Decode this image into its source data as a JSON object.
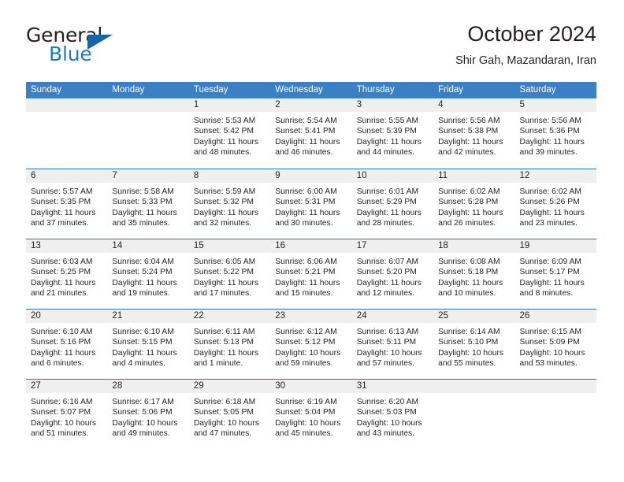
{
  "brand": {
    "name_line1": "General",
    "name_line2": "Blue",
    "logo_icon": "blue-flag-triangle-icon"
  },
  "header": {
    "title": "October 2024",
    "subtitle": "Shir Gah, Mazandaran, Iran"
  },
  "colors": {
    "header_blue": "#3b7fc4",
    "separator_blue": "#2f73b4",
    "daynum_band": "#efefef",
    "brand_blue": "#1f7ac4",
    "logo_blue": "#1565a8",
    "text": "#231f20"
  },
  "weekday_headers": [
    "Sunday",
    "Monday",
    "Tuesday",
    "Wednesday",
    "Thursday",
    "Friday",
    "Saturday"
  ],
  "weeks": [
    [
      {
        "day": "",
        "lines": []
      },
      {
        "day": "",
        "lines": []
      },
      {
        "day": "1",
        "lines": [
          "Sunrise: 5:53 AM",
          "Sunset: 5:42 PM",
          "Daylight: 11 hours",
          "and 48 minutes."
        ]
      },
      {
        "day": "2",
        "lines": [
          "Sunrise: 5:54 AM",
          "Sunset: 5:41 PM",
          "Daylight: 11 hours",
          "and 46 minutes."
        ]
      },
      {
        "day": "3",
        "lines": [
          "Sunrise: 5:55 AM",
          "Sunset: 5:39 PM",
          "Daylight: 11 hours",
          "and 44 minutes."
        ]
      },
      {
        "day": "4",
        "lines": [
          "Sunrise: 5:56 AM",
          "Sunset: 5:38 PM",
          "Daylight: 11 hours",
          "and 42 minutes."
        ]
      },
      {
        "day": "5",
        "lines": [
          "Sunrise: 5:56 AM",
          "Sunset: 5:36 PM",
          "Daylight: 11 hours",
          "and 39 minutes."
        ]
      }
    ],
    [
      {
        "day": "6",
        "lines": [
          "Sunrise: 5:57 AM",
          "Sunset: 5:35 PM",
          "Daylight: 11 hours",
          "and 37 minutes."
        ]
      },
      {
        "day": "7",
        "lines": [
          "Sunrise: 5:58 AM",
          "Sunset: 5:33 PM",
          "Daylight: 11 hours",
          "and 35 minutes."
        ]
      },
      {
        "day": "8",
        "lines": [
          "Sunrise: 5:59 AM",
          "Sunset: 5:32 PM",
          "Daylight: 11 hours",
          "and 32 minutes."
        ]
      },
      {
        "day": "9",
        "lines": [
          "Sunrise: 6:00 AM",
          "Sunset: 5:31 PM",
          "Daylight: 11 hours",
          "and 30 minutes."
        ]
      },
      {
        "day": "10",
        "lines": [
          "Sunrise: 6:01 AM",
          "Sunset: 5:29 PM",
          "Daylight: 11 hours",
          "and 28 minutes."
        ]
      },
      {
        "day": "11",
        "lines": [
          "Sunrise: 6:02 AM",
          "Sunset: 5:28 PM",
          "Daylight: 11 hours",
          "and 26 minutes."
        ]
      },
      {
        "day": "12",
        "lines": [
          "Sunrise: 6:02 AM",
          "Sunset: 5:26 PM",
          "Daylight: 11 hours",
          "and 23 minutes."
        ]
      }
    ],
    [
      {
        "day": "13",
        "lines": [
          "Sunrise: 6:03 AM",
          "Sunset: 5:25 PM",
          "Daylight: 11 hours",
          "and 21 minutes."
        ]
      },
      {
        "day": "14",
        "lines": [
          "Sunrise: 6:04 AM",
          "Sunset: 5:24 PM",
          "Daylight: 11 hours",
          "and 19 minutes."
        ]
      },
      {
        "day": "15",
        "lines": [
          "Sunrise: 6:05 AM",
          "Sunset: 5:22 PM",
          "Daylight: 11 hours",
          "and 17 minutes."
        ]
      },
      {
        "day": "16",
        "lines": [
          "Sunrise: 6:06 AM",
          "Sunset: 5:21 PM",
          "Daylight: 11 hours",
          "and 15 minutes."
        ]
      },
      {
        "day": "17",
        "lines": [
          "Sunrise: 6:07 AM",
          "Sunset: 5:20 PM",
          "Daylight: 11 hours",
          "and 12 minutes."
        ]
      },
      {
        "day": "18",
        "lines": [
          "Sunrise: 6:08 AM",
          "Sunset: 5:18 PM",
          "Daylight: 11 hours",
          "and 10 minutes."
        ]
      },
      {
        "day": "19",
        "lines": [
          "Sunrise: 6:09 AM",
          "Sunset: 5:17 PM",
          "Daylight: 11 hours",
          "and 8 minutes."
        ]
      }
    ],
    [
      {
        "day": "20",
        "lines": [
          "Sunrise: 6:10 AM",
          "Sunset: 5:16 PM",
          "Daylight: 11 hours",
          "and 6 minutes."
        ]
      },
      {
        "day": "21",
        "lines": [
          "Sunrise: 6:10 AM",
          "Sunset: 5:15 PM",
          "Daylight: 11 hours",
          "and 4 minutes."
        ]
      },
      {
        "day": "22",
        "lines": [
          "Sunrise: 6:11 AM",
          "Sunset: 5:13 PM",
          "Daylight: 11 hours",
          "and 1 minute."
        ]
      },
      {
        "day": "23",
        "lines": [
          "Sunrise: 6:12 AM",
          "Sunset: 5:12 PM",
          "Daylight: 10 hours",
          "and 59 minutes."
        ]
      },
      {
        "day": "24",
        "lines": [
          "Sunrise: 6:13 AM",
          "Sunset: 5:11 PM",
          "Daylight: 10 hours",
          "and 57 minutes."
        ]
      },
      {
        "day": "25",
        "lines": [
          "Sunrise: 6:14 AM",
          "Sunset: 5:10 PM",
          "Daylight: 10 hours",
          "and 55 minutes."
        ]
      },
      {
        "day": "26",
        "lines": [
          "Sunrise: 6:15 AM",
          "Sunset: 5:09 PM",
          "Daylight: 10 hours",
          "and 53 minutes."
        ]
      }
    ],
    [
      {
        "day": "27",
        "lines": [
          "Sunrise: 6:16 AM",
          "Sunset: 5:07 PM",
          "Daylight: 10 hours",
          "and 51 minutes."
        ]
      },
      {
        "day": "28",
        "lines": [
          "Sunrise: 6:17 AM",
          "Sunset: 5:06 PM",
          "Daylight: 10 hours",
          "and 49 minutes."
        ]
      },
      {
        "day": "29",
        "lines": [
          "Sunrise: 6:18 AM",
          "Sunset: 5:05 PM",
          "Daylight: 10 hours",
          "and 47 minutes."
        ]
      },
      {
        "day": "30",
        "lines": [
          "Sunrise: 6:19 AM",
          "Sunset: 5:04 PM",
          "Daylight: 10 hours",
          "and 45 minutes."
        ]
      },
      {
        "day": "31",
        "lines": [
          "Sunrise: 6:20 AM",
          "Sunset: 5:03 PM",
          "Daylight: 10 hours",
          "and 43 minutes."
        ]
      },
      {
        "day": "",
        "lines": []
      },
      {
        "day": "",
        "lines": []
      }
    ]
  ]
}
